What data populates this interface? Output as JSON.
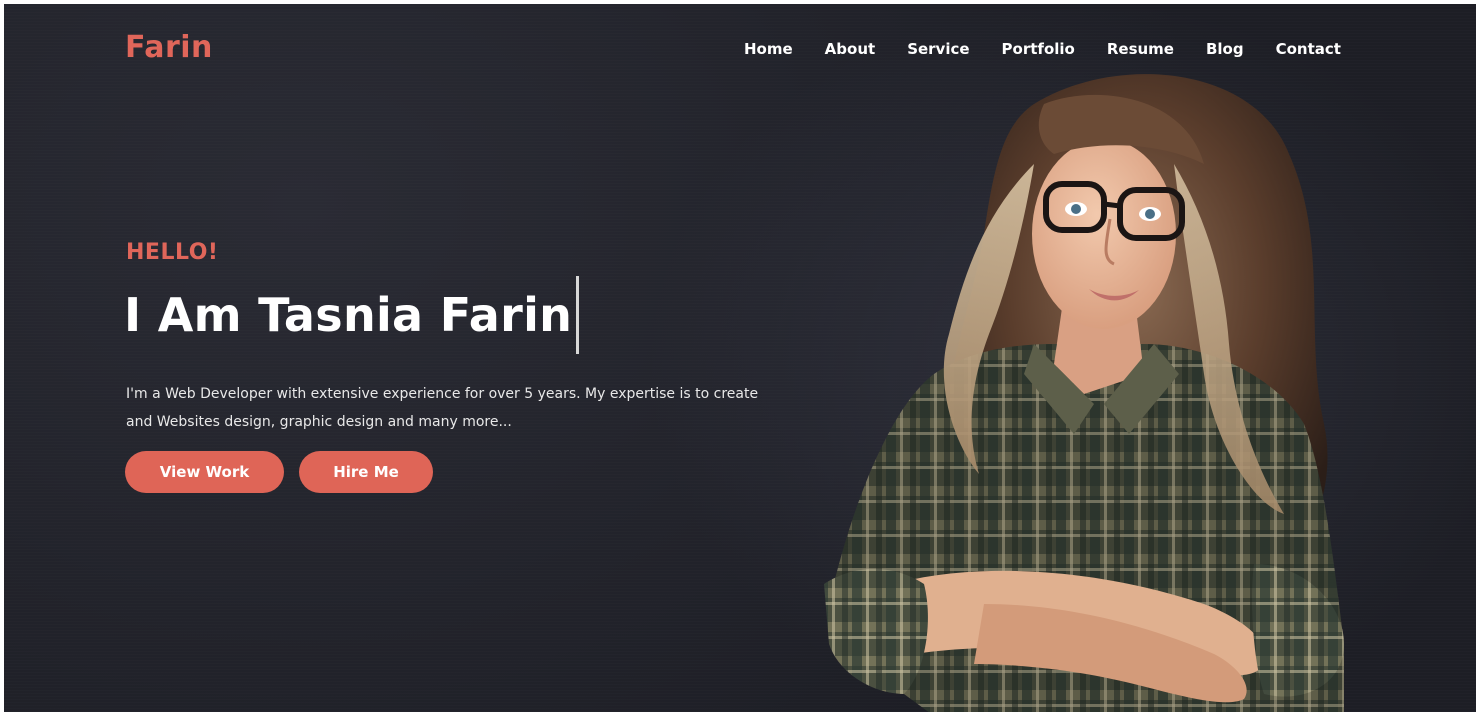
{
  "header": {
    "logo": "Farin",
    "nav": [
      "Home",
      "About",
      "Service",
      "Portfolio",
      "Resume",
      "Blog",
      "Contact"
    ]
  },
  "hero": {
    "greeting": "HELLO!",
    "title": "I Am Tasnia Farin",
    "description": "I'm a Web Developer with extensive experience for over 5 years. My expertise is to create and Websites design, graphic design and many more...",
    "buttons": {
      "view_work": "View Work",
      "hire_me": "Hire Me"
    },
    "portrait_icon": "woman-portrait-photo"
  },
  "colors": {
    "accent": "#e0665a",
    "background": "#23242c",
    "text": "#ffffff"
  }
}
